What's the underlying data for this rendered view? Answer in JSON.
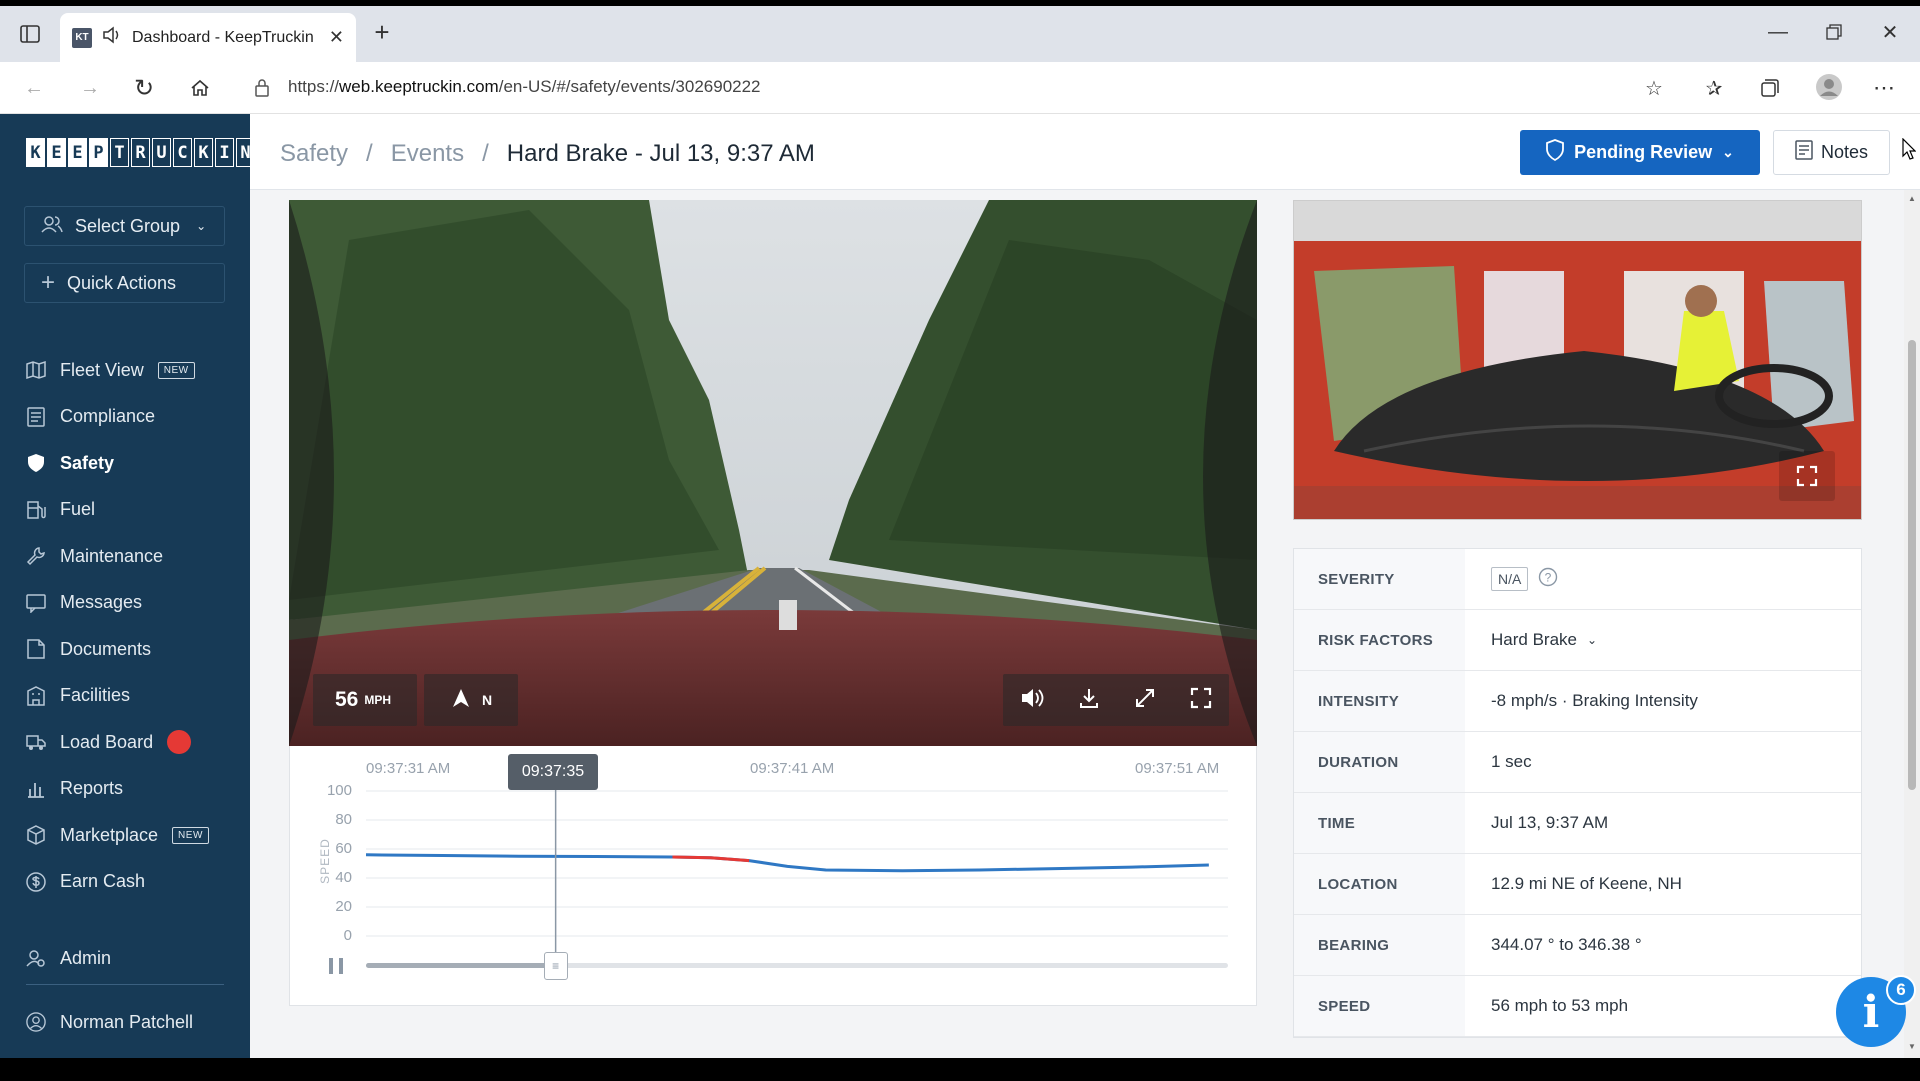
{
  "browser": {
    "tab_title": "Dashboard - KeepTruckin",
    "favicon_text": "KT",
    "url_prefix": "https://",
    "url_domain": "web.keeptruckin.com",
    "url_path": "/en-US/#/safety/events/302690222"
  },
  "sidebar": {
    "logo_letters": [
      "K",
      "E",
      "E",
      "P",
      "T",
      "R",
      "U",
      "C",
      "K",
      "I",
      "N"
    ],
    "select_group": "Select Group",
    "quick_actions": "Quick Actions",
    "items": [
      {
        "label": "Fleet View",
        "badge": "NEW",
        "icon": "map-icon"
      },
      {
        "label": "Compliance",
        "icon": "document-list-icon"
      },
      {
        "label": "Safety",
        "icon": "shield-icon",
        "active": true
      },
      {
        "label": "Fuel",
        "icon": "fuel-pump-icon"
      },
      {
        "label": "Maintenance",
        "icon": "wrench-icon"
      },
      {
        "label": "Messages",
        "icon": "chat-icon"
      },
      {
        "label": "Documents",
        "icon": "documents-icon"
      },
      {
        "label": "Facilities",
        "icon": "building-icon"
      },
      {
        "label": "Load Board",
        "icon": "truck-icon"
      },
      {
        "label": "Reports",
        "icon": "chart-icon"
      },
      {
        "label": "Marketplace",
        "badge": "NEW",
        "icon": "cube-icon"
      },
      {
        "label": "Earn Cash",
        "icon": "dollar-icon"
      }
    ],
    "admin": "Admin",
    "user": "Norman Patchell"
  },
  "header": {
    "breadcrumb": [
      "Safety",
      "Events",
      "Hard Brake - Jul 13, 9:37 AM"
    ],
    "separator": "/",
    "review_button": "Pending Review",
    "notes_button": "Notes"
  },
  "video": {
    "speed_value": "56",
    "speed_unit": "MPH",
    "heading": "N"
  },
  "chart_data": {
    "type": "line",
    "ylabel": "SPEED",
    "ylim": [
      0,
      100
    ],
    "yticks": [
      "100",
      "80",
      "60",
      "40",
      "20",
      "0"
    ],
    "xticks": [
      "09:37:31 AM",
      "09:37:41 AM",
      "09:37:51 AM"
    ],
    "cursor_label": "09:37:35",
    "playback_progress": 0.22,
    "series": [
      {
        "color": "#2f78c4",
        "t_seconds": [
          31,
          33,
          35,
          37,
          39,
          40,
          41,
          42,
          43,
          45,
          47,
          49,
          51,
          53
        ],
        "values": [
          56,
          55.5,
          55,
          54.8,
          54.5,
          54,
          52,
          48,
          45.5,
          45,
          45.5,
          46.5,
          47.5,
          49
        ]
      },
      {
        "color": "#e53935",
        "t_seconds": [
          39,
          40,
          41
        ],
        "values": [
          54.5,
          54,
          52
        ]
      }
    ]
  },
  "details": {
    "rows": [
      {
        "label": "SEVERITY",
        "value": "N/A"
      },
      {
        "label": "RISK FACTORS",
        "value": "Hard Brake"
      },
      {
        "label": "INTENSITY",
        "value": "-8 mph/s  ·  Braking Intensity"
      },
      {
        "label": "DURATION",
        "value": "1 sec"
      },
      {
        "label": "TIME",
        "value": "Jul 13, 9:37 AM"
      },
      {
        "label": "LOCATION",
        "value": "12.9 mi NE of Keene, NH"
      },
      {
        "label": "BEARING",
        "value": "344.07 ° to 346.38 °"
      },
      {
        "label": "SPEED",
        "value": "56 mph to 53 mph"
      }
    ]
  },
  "help": {
    "badge_count": "6",
    "icon": "info-icon"
  }
}
